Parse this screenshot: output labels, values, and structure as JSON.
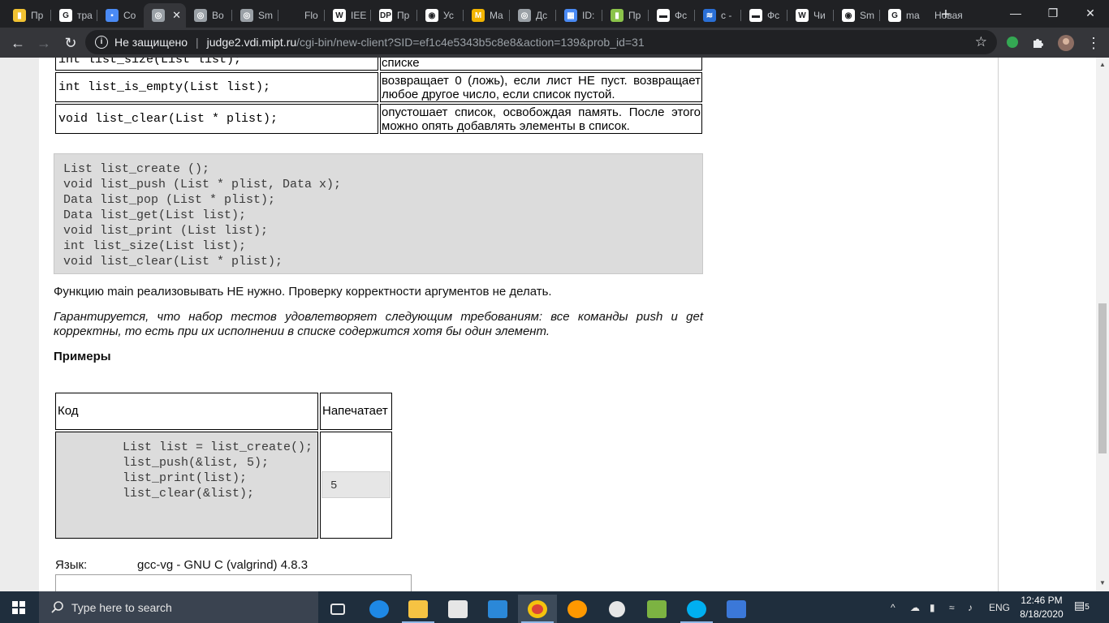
{
  "browser": {
    "tabs": [
      {
        "label": "Пр",
        "fav": "#f1c232",
        "glyph": "▮",
        "sep": true
      },
      {
        "label": "тра",
        "fav": "#ffffff",
        "glyph": "G",
        "sep": true
      },
      {
        "label": "Co",
        "fav": "#4a8af4",
        "glyph": "▪",
        "sep": false
      },
      {
        "label": "",
        "fav": "#9aa0a6",
        "glyph": "◎",
        "active": true
      },
      {
        "label": "Во",
        "fav": "#9aa0a6",
        "glyph": "◎",
        "sep": true
      },
      {
        "label": "Sm",
        "fav": "#9aa0a6",
        "glyph": "◎",
        "sep": true
      },
      {
        "label": "Flo",
        "fav": "#202124",
        "glyph": "",
        "sep": true
      },
      {
        "label": "IEE",
        "fav": "#ffffff",
        "glyph": "W",
        "sep": true
      },
      {
        "label": "Пр",
        "fav": "#ffffff",
        "glyph": "DP",
        "sep": true
      },
      {
        "label": "Ус",
        "fav": "#ffffff",
        "glyph": "◉",
        "sep": true
      },
      {
        "label": "Ma",
        "fav": "#f2b400",
        "glyph": "M",
        "sep": true
      },
      {
        "label": "Дс",
        "fav": "#9aa0a6",
        "glyph": "◎",
        "sep": true
      },
      {
        "label": "ID:",
        "fav": "#4a8af4",
        "glyph": "▦",
        "sep": true
      },
      {
        "label": "Пр",
        "fav": "#8bc34a",
        "glyph": "▮",
        "sep": true
      },
      {
        "label": "Фс",
        "fav": "#ffffff",
        "glyph": "▬",
        "sep": true
      },
      {
        "label": "c -",
        "fav": "#2a6fd6",
        "glyph": "≋",
        "sep": true
      },
      {
        "label": "Фс",
        "fav": "#ffffff",
        "glyph": "▬",
        "sep": true
      },
      {
        "label": "Чи",
        "fav": "#ffffff",
        "glyph": "W",
        "sep": true
      },
      {
        "label": "Sm",
        "fav": "#ffffff",
        "glyph": "◉",
        "sep": true
      },
      {
        "label": "ma",
        "fav": "#ffffff",
        "glyph": "G",
        "sep": false
      },
      {
        "label": "Новая",
        "fav": "",
        "glyph": "",
        "sep": false
      }
    ],
    "not_secure": "Не защищено",
    "url_host": "judge2.vdi.mipt.ru",
    "url_path": "/cgi-bin/new-client?SID=ef1c4e5343b5c8e8&action=139&prob_id=31"
  },
  "page": {
    "functions": [
      {
        "sig": "int list_size(List list);",
        "desc": "списке"
      },
      {
        "sig": "int list_is_empty(List list);",
        "desc": "возвращает 0 (ложь), если лист НЕ пуст. возвращает любое другое число, если список пустой."
      },
      {
        "sig": "void list_clear(List * plist);",
        "desc": "опустошает список, освобождая память. После этого можно опять добавлять элементы в список."
      }
    ],
    "code": "List list_create ();\nvoid list_push (List * plist, Data x);\nData list_pop (List * plist);\nData list_get(List list);\nvoid list_print (List list);\nint list_size(List list);\nvoid list_clear(List * plist);",
    "note_main": "Функцию main реализовывать НЕ нужно. Проверку корректности аргументов не делать.",
    "note_guarantee": "Гарантируется, что набор тестов удовлетворяет следующим требованиям: все команды push и get корректны, то есть при их исполнении в списке содержится хотя бы один элемент.",
    "examples_heading": "Примеры",
    "example": {
      "col_code": "Код",
      "col_output": "Напечатает",
      "code": "List list = list_create();\nlist_push(&list, 5);\nlist_print(list);\nlist_clear(&list);",
      "output": "5"
    },
    "language_label": "Язык:",
    "language_value": "gcc-vg - GNU C (valgrind) 4.8.3"
  },
  "taskbar": {
    "search_placeholder": "Type here to search",
    "lang": "ENG",
    "time": "12:46 PM",
    "date": "8/18/2020",
    "notifications": "5"
  }
}
